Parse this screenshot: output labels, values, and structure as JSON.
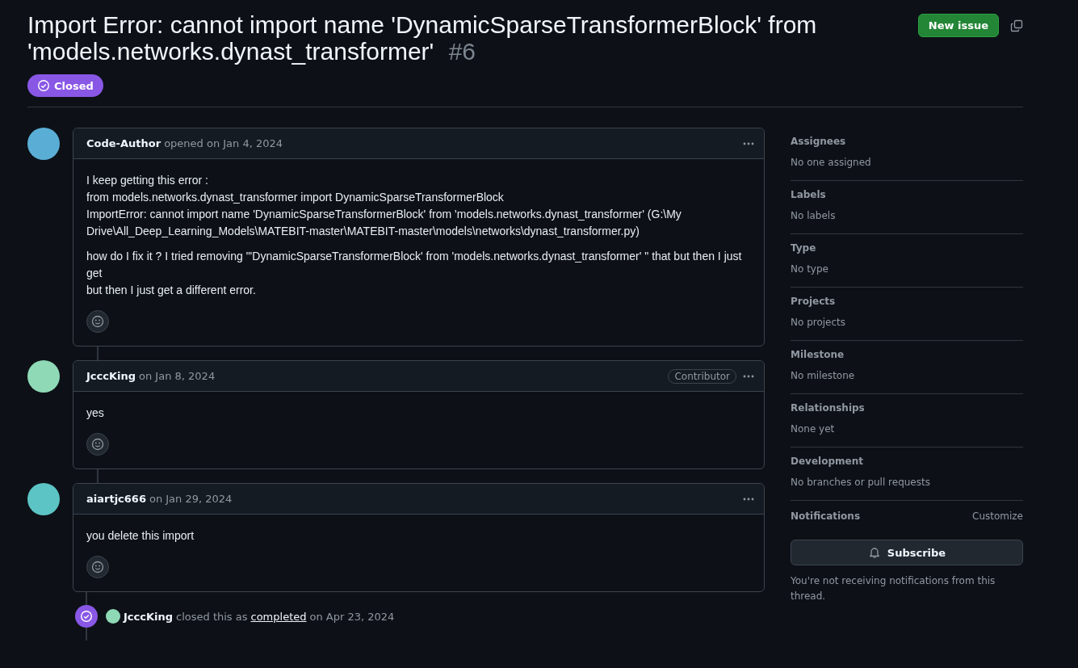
{
  "issue": {
    "title": "Import Error: cannot import name 'DynamicSparseTransformerBlock' from 'models.networks.dynast_transformer'",
    "number": "#6",
    "closed": true,
    "state_label": "Closed"
  },
  "header_actions": {
    "new_issue": "New issue"
  },
  "comments": [
    {
      "author": "Code-Author",
      "meta": "opened on Jan 4, 2024",
      "color": "#5aaed6",
      "paragraphs": [
        [
          "I keep getting this error :",
          "from models.networks.dynast_transformer import DynamicSparseTransformerBlock",
          "ImportError: cannot import name 'DynamicSparseTransformerBlock' from 'models.networks.dynast_transformer' (G:\\My Drive\\All_Deep_Learning_Models\\MATEBIT-master\\MATEBIT-master\\models\\networks\\dynast_transformer.py)"
        ],
        [
          "how do I fix it ? I tried removing \"'DynamicSparseTransformerBlock' from 'models.networks.dynast_transformer' \" that but then I just get",
          "but then I just get a different error."
        ]
      ]
    },
    {
      "author": "JcccKing",
      "meta": "on Jan 8, 2024",
      "color": "#8fd9b6",
      "badge": "Contributor",
      "paragraphs": [
        [
          "yes"
        ]
      ]
    },
    {
      "author": "aiartjc666",
      "meta": "on Jan 29, 2024",
      "color": "#5cc4c4",
      "paragraphs": [
        [
          "you delete this import"
        ]
      ]
    }
  ],
  "events": [
    {
      "kind": "closed",
      "actor": "JcccKing",
      "color": "#8fd9b6",
      "text_before": "closed this as",
      "link": "completed",
      "text_after": "on Apr 23, 2024"
    }
  ],
  "sidebar": {
    "sections": [
      {
        "heading": "Assignees",
        "value": "No one assigned"
      },
      {
        "heading": "Labels",
        "value": "No labels"
      },
      {
        "heading": "Type",
        "value": "No type"
      },
      {
        "heading": "Projects",
        "value": "No projects"
      },
      {
        "heading": "Milestone",
        "value": "No milestone"
      },
      {
        "heading": "Relationships",
        "value": "None yet"
      },
      {
        "heading": "Development",
        "value": "No branches or pull requests"
      }
    ],
    "notifications": {
      "heading": "Notifications",
      "customize": "Customize",
      "button": "Subscribe",
      "note": "You're not receiving notifications from this thread."
    }
  }
}
